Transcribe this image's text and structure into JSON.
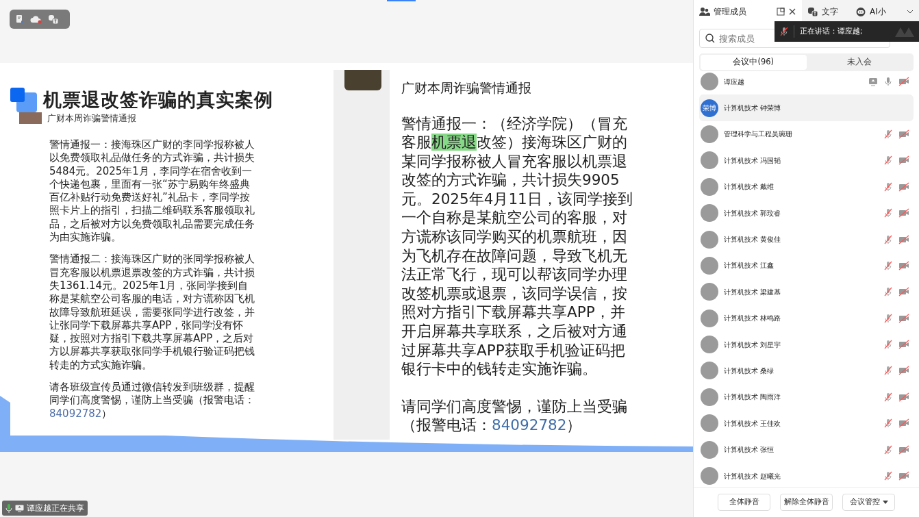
{
  "slide": {
    "title": "机票退改签诈骗的真实案例",
    "subtitle": "广财本周诈骗警情通报",
    "paragraphs": [
      [
        {
          "kind": "plain",
          "text": "警情通报一：接海珠区广财的李同学报称被人以免费领取礼品做任务的方式诈骗，共计损失5484元。2025年1月，李同学在宿舍收到一个快递包裹，里面有一张“苏宁易购年终盛典百亿补贴行动免费送好礼”礼品卡，李同学按照卡片上的指引，扫描二维码联系客服领取礼品，之后被对方以免费领取礼品需要完成任务为由实施诈骗。"
        }
      ],
      [
        {
          "kind": "plain",
          "text": "警情通报二：接海珠区广财的张同学报称被人冒充客服以机票退票改签的方式诈骗，共计损失1361.14元。2025年1月，张同学接到自称是某航空公司客服的电话，对方谎称因飞机故障导致航班延误，需要张同学进行改签，并让张同学下载屏幕共享APP，张同学没有怀疑，按照对方指引下载共享屏幕APP，之后对方以屏幕共享获取张同学手机银行验证码把钱转走的方式实施诈骗。"
        }
      ],
      [
        {
          "kind": "plain",
          "text": "请各班级宣传员通过微信转发到班级群，提醒同学们高度警惕，谨防上当受骗（报警电话："
        },
        {
          "kind": "phone",
          "text": "84092782"
        },
        {
          "kind": "plain",
          "text": "）"
        }
      ]
    ],
    "chat": {
      "title": "广财本周诈骗警情通报",
      "paragraphs": [
        [
          {
            "kind": "plain",
            "text": "警情通报一：（经济学院）（冒充客服"
          },
          {
            "kind": "highlight",
            "text": "机票退"
          },
          {
            "kind": "plain",
            "text": "改签）接海珠区广财的某同学报称被人冒充客服以机票退改签的方式诈骗，共计损失9905元。2025年4月11日，该同学接到一个自称是某航空公司的客服，对方谎称该同学购买的机票航班，因为飞机存在故障问题，导致飞机无法正常飞行，现可以帮该同学办理改签机票或退票，该同学误信，按照对方指引下载屏幕共享APP，并开启屏幕共享联系，之后被对方通过屏幕共享APP获取手机验证码把银行卡中的钱转走实施诈骗。"
          }
        ],
        [
          {
            "kind": "plain",
            "text": "请同学们高度警惕，谨防上当受骗（报警电话："
          },
          {
            "kind": "phone",
            "text": "84092782"
          },
          {
            "kind": "plain",
            "text": "）"
          }
        ]
      ]
    }
  },
  "sharing_status": "谭应越正在共享",
  "panel": {
    "tabs": [
      {
        "kind": "members",
        "label": "管理成员",
        "selected": true
      },
      {
        "kind": "transcript",
        "label": "文字",
        "selected": false
      },
      {
        "kind": "assistant",
        "label": "AI小",
        "selected": false
      }
    ],
    "speaking_tooltip": "正在讲话：谭应越;",
    "search": {
      "placeholder": "搜索成员"
    },
    "segments": [
      {
        "label": "会议中(96)",
        "selected": true
      },
      {
        "label": "未入会",
        "selected": false
      }
    ],
    "members": [
      {
        "name": "谭应越",
        "selected": false,
        "sharing": true,
        "mic_muted": false,
        "camera_off": true
      },
      {
        "name": "计算机技术 钟荣博",
        "avatar_text": "荣博",
        "selected": true
      },
      {
        "name": "管理科学与工程吴琬珊",
        "selected": false,
        "mic_muted": true,
        "camera_off": true
      },
      {
        "name": "计算机技术  冯国韬",
        "selected": false,
        "mic_muted": true,
        "camera_off": true
      },
      {
        "name": "计算机技术 戴维",
        "selected": false,
        "mic_muted": true,
        "camera_off": true
      },
      {
        "name": "计算机技术 郭玟睿",
        "selected": false,
        "mic_muted": true,
        "camera_off": true
      },
      {
        "name": "计算机技术 黄俊佳",
        "selected": false,
        "mic_muted": true,
        "camera_off": true
      },
      {
        "name": "计算机技术 江鑫",
        "selected": false,
        "mic_muted": true,
        "camera_off": true
      },
      {
        "name": "计算机技术 梁建基",
        "selected": false,
        "mic_muted": true,
        "camera_off": true
      },
      {
        "name": "计算机技术 林鸣路",
        "selected": false,
        "mic_muted": true,
        "camera_off": true
      },
      {
        "name": "计算机技术 刘星宇",
        "selected": false,
        "mic_muted": true,
        "camera_off": true
      },
      {
        "name": "计算机技术 桑绿",
        "selected": false,
        "mic_muted": true,
        "camera_off": true
      },
      {
        "name": "计算机技术 陶雨洋",
        "selected": false,
        "mic_muted": true,
        "camera_off": true
      },
      {
        "name": "计算机技术 王佳欢",
        "selected": false,
        "mic_muted": true,
        "camera_off": true
      },
      {
        "name": "计算机技术 张恒",
        "selected": false,
        "mic_muted": true,
        "camera_off": true
      },
      {
        "name": "计算机技术 赵曦光",
        "selected": false,
        "mic_muted": true,
        "camera_off": true
      }
    ],
    "buttons": [
      {
        "label": "全体静音",
        "dropdown": false
      },
      {
        "label": "解除全体静音",
        "dropdown": false
      },
      {
        "label": "会议管控",
        "dropdown": true
      }
    ]
  }
}
